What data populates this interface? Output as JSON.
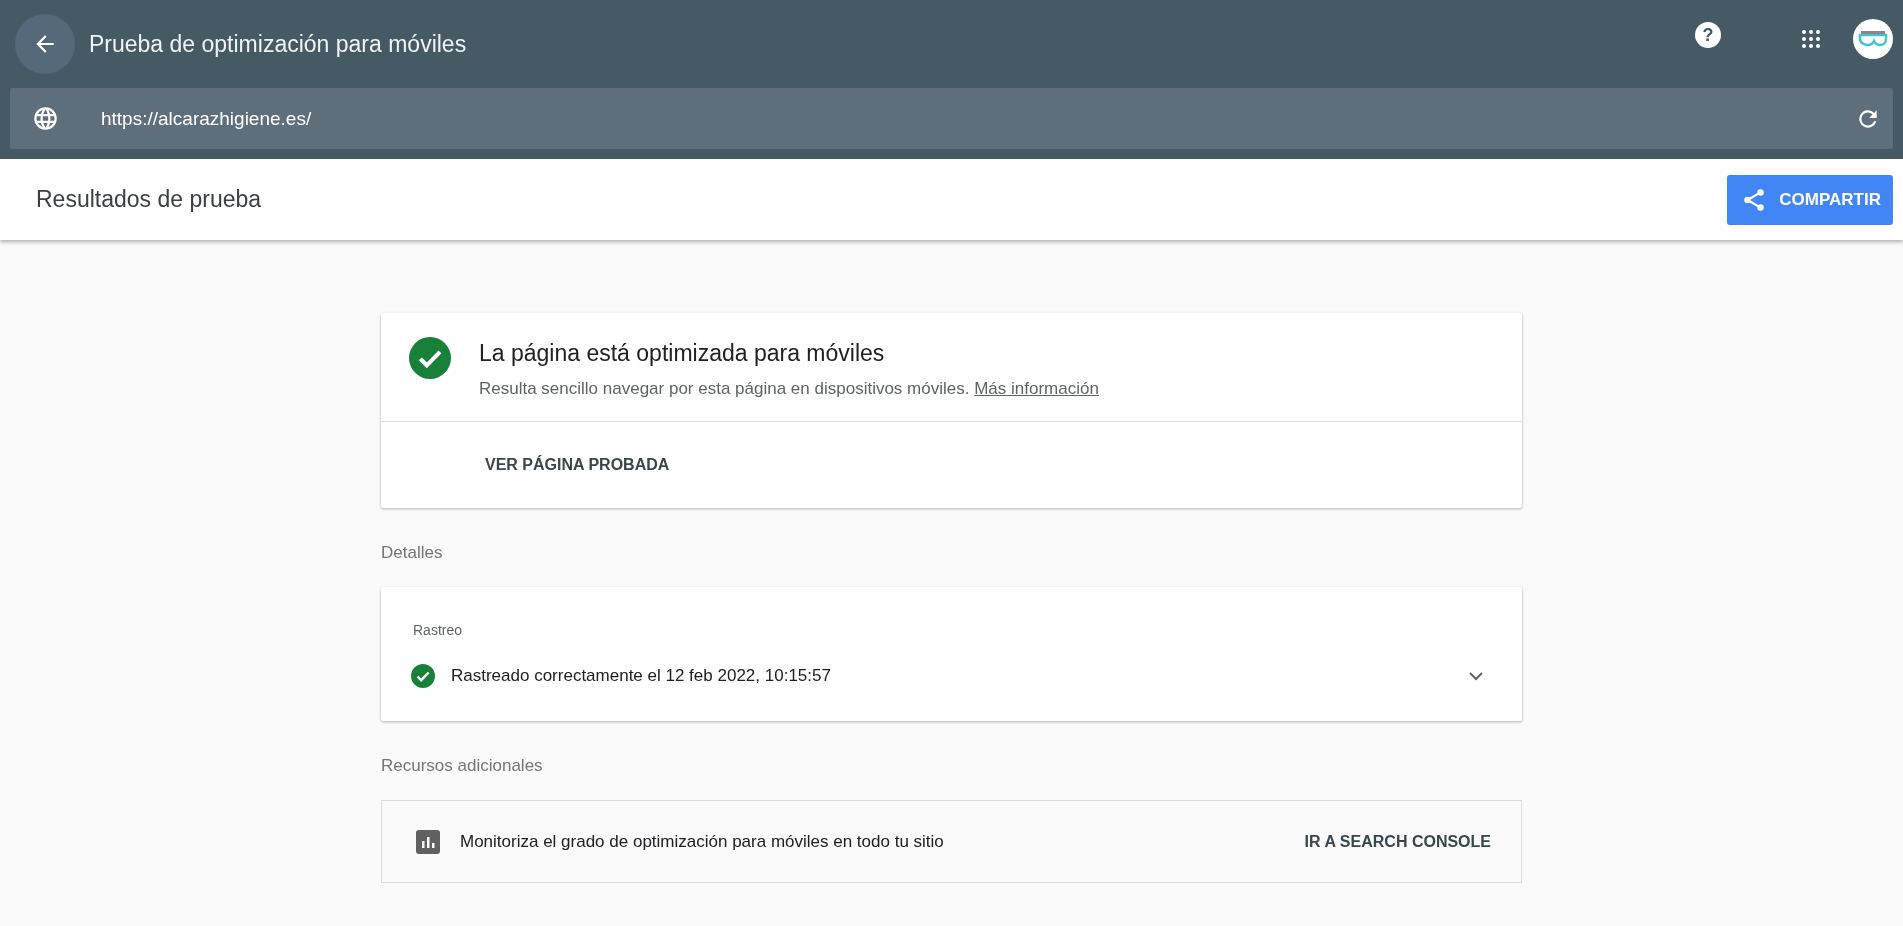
{
  "app_bar": {
    "title": "Prueba de optimización para móviles",
    "help_button": "?"
  },
  "url_bar": {
    "value": "https://alcarazhigiene.es/"
  },
  "results_header": {
    "title": "Resultados de prueba",
    "share_button": "COMPARTIR"
  },
  "verdict_card": {
    "title": "La página está optimizada para móviles",
    "description": "Resulta sencillo navegar por esta página en dispositivos móviles.",
    "link": "Más información",
    "action": "VER PÁGINA PROBADA"
  },
  "details": {
    "heading": "Detalles",
    "section_label": "Rastreo",
    "status_text": "Rastreado correctamente el 12 feb 2022, 10:15:57",
    "expanded": false
  },
  "resources": {
    "heading": "Recursos adicionales",
    "text": "Monitoriza el grado de optimización para móviles en todo tu sitio",
    "action": "IR A SEARCH CONSOLE"
  }
}
